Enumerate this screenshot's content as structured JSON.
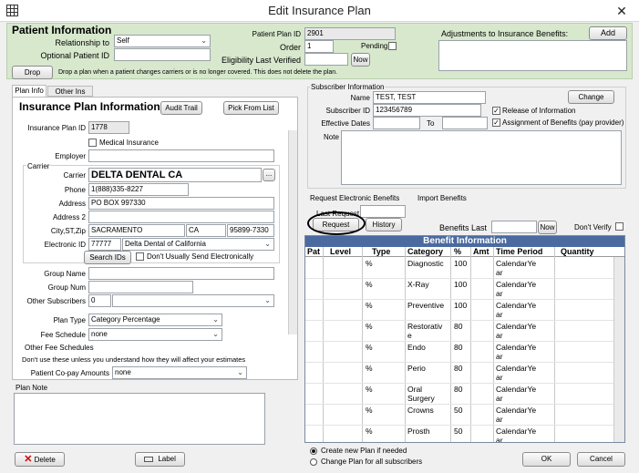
{
  "window": {
    "title": "Edit Insurance Plan",
    "close": "✕"
  },
  "patient": {
    "heading": "Patient Information",
    "relationship_label": "Relationship to",
    "relationship_value": "Self",
    "optional_id_label": "Optional Patient ID",
    "optional_id_value": "",
    "plan_id_label": "Patient Plan ID",
    "plan_id_value": "2901",
    "order_label": "Order",
    "order_value": "1",
    "pending_label": "Pending",
    "elig_label": "Eligibility Last Verified",
    "elig_value": "",
    "now_label": "Now",
    "drop_label": "Drop",
    "drop_note": "Drop a plan when a patient changes carriers or is no longer covered.  This does not delete the plan.",
    "adjust_label": "Adjustments to Insurance Benefits:",
    "add_label": "Add"
  },
  "tabs": {
    "plan_info": "Plan Info",
    "other_ins": "Other Ins Info"
  },
  "plan": {
    "heading": "Insurance Plan Information",
    "audit_trail": "Audit Trail",
    "pick_from_list": "Pick From List",
    "plan_id_label": "Insurance Plan ID",
    "plan_id_value": "1778",
    "medical_label": "Medical Insurance",
    "employer_label": "Employer",
    "employer_value": "",
    "carrier_group": "Carrier",
    "carrier_label": "Carrier",
    "carrier_value": "DELTA DENTAL CA",
    "carrier_btn": "...",
    "phone_label": "Phone",
    "phone_value": "1(888)335-8227",
    "address_label": "Address",
    "address_value": "PO BOX 997330",
    "address2_label": "Address 2",
    "address2_value": "",
    "city_label": "City,ST,Zip",
    "city_value": "SACRAMENTO",
    "state_value": "CA",
    "zip_value": "95899-7330",
    "eid_label": "Electronic ID",
    "eid_value": "77777",
    "eid_name": "Delta Dental of California",
    "search_ids": "Search IDs",
    "dont_send_label": "Don't Usually Send Electronically",
    "group_name_label": "Group Name",
    "group_num_label": "Group Num",
    "other_subs_label": "Other Subscribers",
    "other_subs_value": "0",
    "plan_type_label": "Plan Type",
    "plan_type_value": "Category Percentage",
    "fee_sched_label": "Fee Schedule",
    "fee_sched_value": "none",
    "other_fee_label": "Other Fee Schedules",
    "warn_text": "Don't use these unless you understand how they will affect your estimates",
    "copay_label": "Patient Co-pay Amounts",
    "copay_value": "none",
    "plan_note_label": "Plan Note"
  },
  "subscriber": {
    "group_label": "Subscriber Information",
    "name_label": "Name",
    "name_value": "TEST, TEST",
    "change_label": "Change",
    "sub_id_label": "Subscriber ID",
    "sub_id_value": "123456789",
    "release_label": "Release of Information",
    "eff_label": "Effective Dates",
    "to_label": "To",
    "assign_label": "Assignment of Benefits (pay provider)",
    "note_label": "Note"
  },
  "elec": {
    "req_group": "Request Electronic Benefits",
    "import_group": "Import Benefits",
    "last_request_label": "Last Request",
    "request_btn": "Request",
    "history_btn": "History",
    "benefits_last_label": "Benefits Last",
    "now_label": "Now",
    "dont_verify_label": "Don't Verify"
  },
  "benefits": {
    "heading": "Benefit Information",
    "columns": [
      "Pat",
      "Level",
      "Type",
      "Category",
      "%",
      "Amt",
      "Time Period",
      "Quantity"
    ],
    "rows": [
      {
        "type": "%",
        "cat1": "Diagnostic",
        "cat2": "",
        "pct": "100",
        "tp1": "CalendarYe",
        "tp2": "ar"
      },
      {
        "type": "%",
        "cat1": "X-Ray",
        "cat2": "",
        "pct": "100",
        "tp1": "CalendarYe",
        "tp2": "ar"
      },
      {
        "type": "%",
        "cat1": "Preventive",
        "cat2": "",
        "pct": "100",
        "tp1": "CalendarYe",
        "tp2": "ar"
      },
      {
        "type": "%",
        "cat1": "Restorativ",
        "cat2": "e",
        "pct": "80",
        "tp1": "CalendarYe",
        "tp2": "ar"
      },
      {
        "type": "%",
        "cat1": "Endo",
        "cat2": "",
        "pct": "80",
        "tp1": "CalendarYe",
        "tp2": "ar"
      },
      {
        "type": "%",
        "cat1": "Perio",
        "cat2": "",
        "pct": "80",
        "tp1": "CalendarYe",
        "tp2": "ar"
      },
      {
        "type": "%",
        "cat1": "Oral",
        "cat2": "Surgery",
        "pct": "80",
        "tp1": "CalendarYe",
        "tp2": "ar"
      },
      {
        "type": "%",
        "cat1": "Crowns",
        "cat2": "",
        "pct": "50",
        "tp1": "CalendarYe",
        "tp2": "ar"
      },
      {
        "type": "%",
        "cat1": "Prosth",
        "cat2": "",
        "pct": "50",
        "tp1": "CalendarYe",
        "tp2": "ar"
      }
    ]
  },
  "footer": {
    "delete": "Delete",
    "label": "Label",
    "create_new": "Create new Plan if needed",
    "change_all": "Change Plan for all subscribers",
    "ok": "OK",
    "cancel": "Cancel"
  }
}
